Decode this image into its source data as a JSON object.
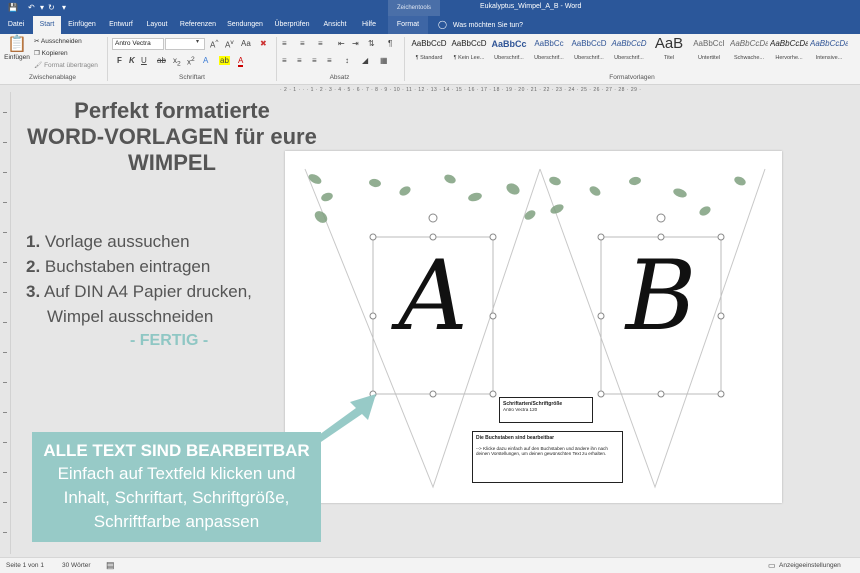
{
  "titlebar": {
    "context_label": "Zeichentools",
    "doc_title": "Eukalyptus_Wimpel_A_B  -  Word"
  },
  "tabs": [
    {
      "label": "Datei"
    },
    {
      "label": "Start"
    },
    {
      "label": "Einfügen"
    },
    {
      "label": "Entwurf"
    },
    {
      "label": "Layout"
    },
    {
      "label": "Referenzen"
    },
    {
      "label": "Sendungen"
    },
    {
      "label": "Überprüfen"
    },
    {
      "label": "Ansicht"
    },
    {
      "label": "Hilfe"
    },
    {
      "label": "Format"
    }
  ],
  "tell_me": "Was möchten Sie tun?",
  "ribbon": {
    "clipboard": {
      "paste": "Einfügen",
      "cut": "Ausschneiden",
      "copy": "Kopieren",
      "format_painter": "Format übertragen",
      "label": "Zwischenablage"
    },
    "font": {
      "name": "Antro Vectra",
      "size": "",
      "label": "Schriftart",
      "bold": "F",
      "italic": "K",
      "underline": "U"
    },
    "paragraph": {
      "label": "Absatz"
    },
    "styles": {
      "label": "Formatvorlagen",
      "items": [
        {
          "preview": "AaBbCcD",
          "name": "¶ Standard"
        },
        {
          "preview": "AaBbCcD",
          "name": "¶ Kein Lee..."
        },
        {
          "preview": "AaBbCc",
          "name": "Überschrif..."
        },
        {
          "preview": "AaBbCc",
          "name": "Überschrif..."
        },
        {
          "preview": "AaBbCcD",
          "name": "Überschrif..."
        },
        {
          "preview": "AaBbCcD",
          "name": "Überschrif..."
        },
        {
          "preview": "AaB",
          "name": "Titel"
        },
        {
          "preview": "AaBbCcI",
          "name": "Untertitel"
        },
        {
          "preview": "AaBbCcDa",
          "name": "Schwache..."
        },
        {
          "preview": "AaBbCcDa",
          "name": "Hervorhe..."
        },
        {
          "preview": "AaBbCcDa",
          "name": "Intensive..."
        }
      ]
    }
  },
  "ruler_text": "· 2 · 1 · · · 1 · 2 · 3 · 4 · 5 · 6 · 7 · 8 · 9 · 10 · 11 · 12 · 13 · 14 · 15 · 16 · 17 · 18 · 19 · 20 · 21 · 22 · 23 · 24 · 25 · 26 · 27 · 28 · 29 ·",
  "promo": {
    "headline_lines": [
      "Perfekt formatierte",
      "WORD-VORLAGEN für eure",
      "WIMPEL"
    ],
    "steps": [
      {
        "num": "1.",
        "text": "Vorlage aussuchen"
      },
      {
        "num": "2.",
        "text": "Buchstaben eintragen"
      },
      {
        "num": "3.",
        "text": "Auf DIN A4 Papier drucken,"
      },
      {
        "num": "",
        "text": "Wimpel ausschneiden"
      }
    ],
    "fertig": "- FERTIG -",
    "callout_heading": "ALLE TEXT SIND BEARBEITBAR",
    "callout_lines": [
      "Einfach auf Textfeld klicken und",
      "Inhalt, Schriftart, Schriftgröße,",
      "Schriftfarbe anpassen"
    ],
    "accent_color": "#97cac7"
  },
  "document": {
    "letters": [
      "A",
      "B"
    ],
    "box1_title": "Schriftarten/Schriftgröße",
    "box1_text": "Antro Vectra 120",
    "box2_title": "Die Buchstaben sind bearbeitbar",
    "box2_text": "--> Klicke dazu einfach auf den Buchstaben und ändere ihn nach deinen Vorstellungen, um deinen gewünschten Text zu erhalten."
  },
  "status": {
    "page": "Seite 1 von 1",
    "words": "30 Wörter",
    "display_settings": "Anzeigeeinstellungen"
  }
}
